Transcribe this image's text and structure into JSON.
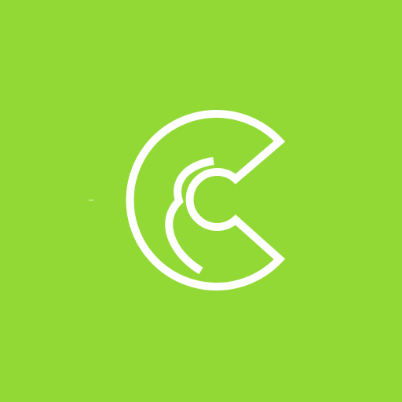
{
  "screen": {
    "background_color": "#93d935",
    "logo": {
      "icon": "c-letter-logo-icon",
      "stroke_color": "#ffffff"
    }
  }
}
